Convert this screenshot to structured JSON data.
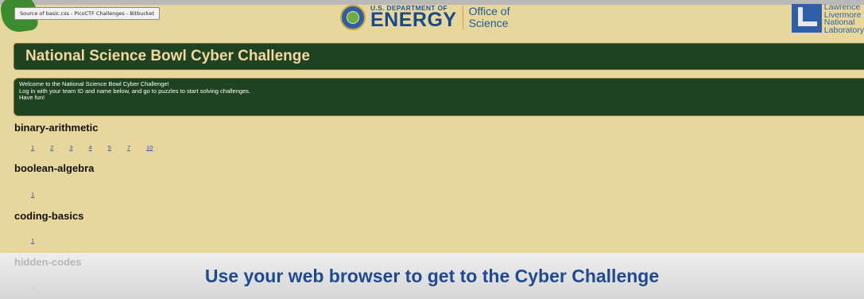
{
  "tooltip": "Source of basic.css - PicoCTF Challenges - Bitbucket",
  "doe": {
    "small": "U.S. DEPARTMENT OF",
    "big": "ENERGY",
    "office_line1": "Office of",
    "office_line2": "Science"
  },
  "llnl": [
    "Lawrence",
    "Livermore",
    "National",
    "Laboratory"
  ],
  "banner": "National Science Bowl Cyber Challenge",
  "welcome": [
    "Welcome to the National Science Bowl Cyber Challenge!",
    "Log in with your team ID and name below, and go to puzzles to start solving challenges.",
    "Have fun!"
  ],
  "sections": [
    {
      "title": "binary-arithmetic",
      "links": [
        "1",
        "2",
        "3",
        "4",
        "5",
        "7",
        "10"
      ]
    },
    {
      "title": "boolean-algebra",
      "links": [
        "1"
      ]
    },
    {
      "title": "coding-basics",
      "links": [
        "1"
      ]
    },
    {
      "title": "hidden-codes",
      "links": [
        "1"
      ]
    }
  ],
  "overlay": "Use your web browser to get to the Cyber Challenge",
  "colors": {
    "background": "#e8d79c",
    "banner": "#1f4220",
    "link": "#2a58a8",
    "overlay_text": "#1f4a92"
  }
}
